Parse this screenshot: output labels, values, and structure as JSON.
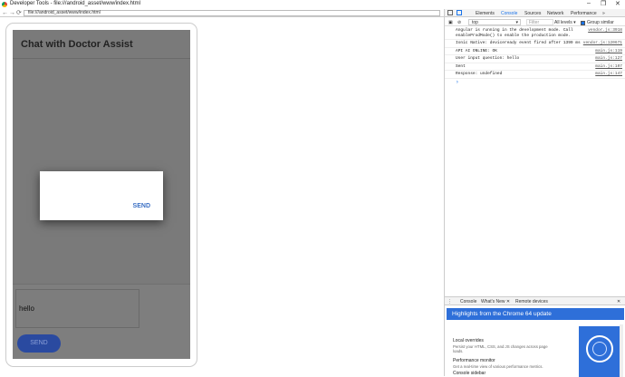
{
  "window": {
    "title": "Developer Tools - file:///android_asset/www/index.html",
    "controls": [
      "–",
      "❐",
      "✕"
    ]
  },
  "browser": {
    "url": "file:///android_asset/www/index.html",
    "nav": [
      "←",
      "→",
      "⟳"
    ]
  },
  "app": {
    "title": "Chat with Doctor Assist",
    "input_value": "hello",
    "send_label": "SEND",
    "dialog_send_label": "SEND"
  },
  "devtools": {
    "tabs": [
      "Elements",
      "Console",
      "Sources",
      "Network",
      "Performance",
      "»"
    ],
    "active_tab": "Console",
    "context": "top",
    "filter_placeholder": "Filter",
    "levels": "All levels ▾",
    "group_similar": "Group similar",
    "logs": [
      {
        "text": "Angular is running in the development mode. Call enableProdMode() to enable the production mode.",
        "src": "vendor.js:3918"
      },
      {
        "text": "Ionic Native: deviceready event fired after 1399 ms",
        "src": "vendor.js:120671"
      },
      {
        "text": "API AI ONLINE:  OK",
        "src": "main.js:119"
      },
      {
        "text": "User input question: hello",
        "src": "main.js:127"
      },
      {
        "text": "Sent",
        "src": "main.js:107"
      },
      {
        "text": "Response: undefined",
        "src": "main.js:147"
      }
    ],
    "prompt": "›",
    "drawer_tabs": [
      "Console",
      "What's New ✕",
      "Remote devices"
    ],
    "banner": "Highlights from the Chrome 64 update",
    "features": [
      {
        "title": "Local overrides",
        "desc": "Persist your HTML, CSS, and JS changes across page loads."
      },
      {
        "title": "Performance monitor",
        "desc": "Get a real-time view of various performance metrics."
      },
      {
        "title": "Console sidebar",
        "desc": ""
      }
    ]
  },
  "colors": {
    "accent": "#3a6fc4",
    "button_bg": "#2a4aa0",
    "overlay": "#7a7a7a",
    "devtools_banner": "#2e6fd9"
  }
}
